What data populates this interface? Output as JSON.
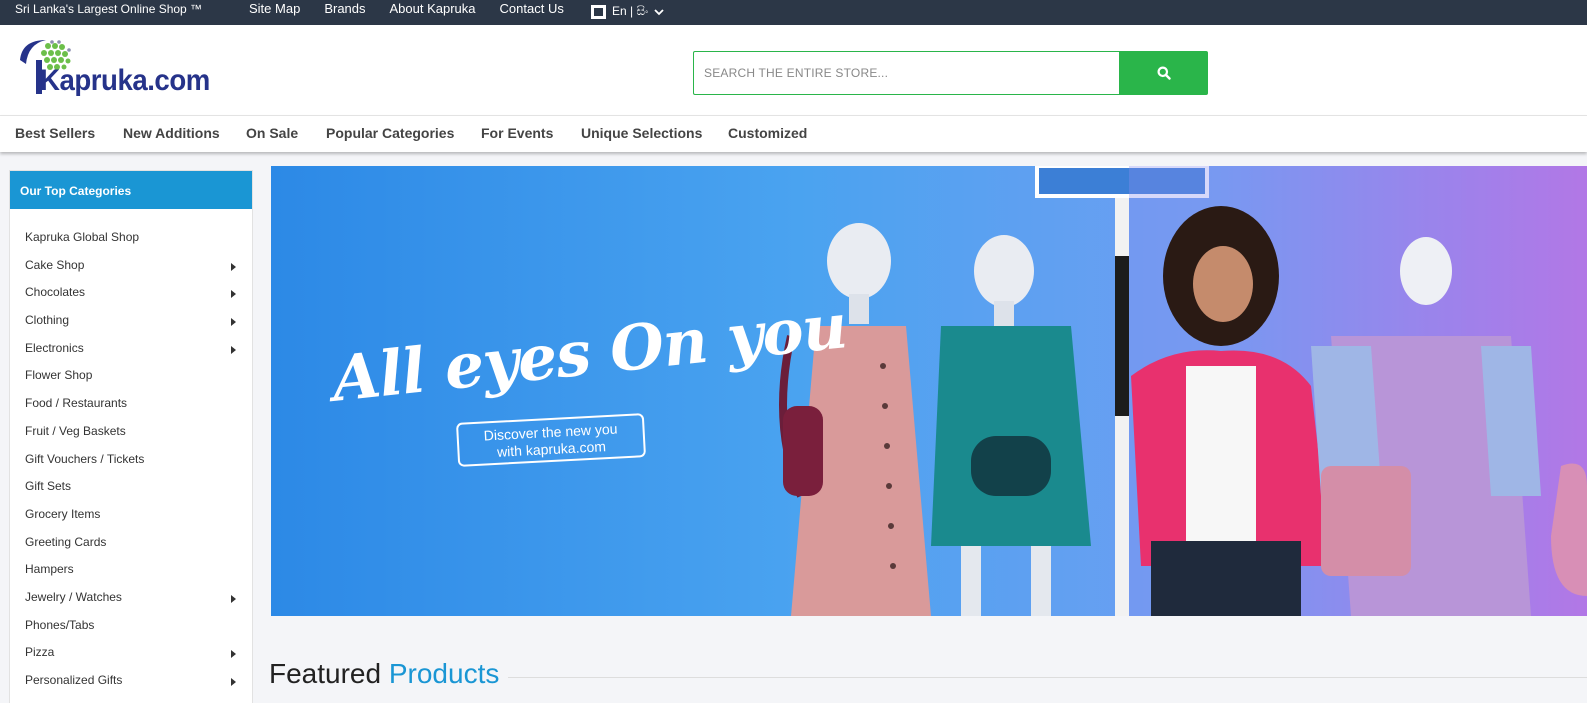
{
  "topbar": {
    "tagline": "Sri Lanka's Largest Online Shop ™",
    "links": [
      "Site Map",
      "Brands",
      "About Kapruka",
      "Contact Us"
    ],
    "language": "En | සිං"
  },
  "header": {
    "logo_text": "Kapruka.com",
    "search_placeholder": "SEARCH THE ENTIRE STORE..."
  },
  "nav": {
    "items": [
      "Best Sellers",
      "New Additions",
      "On Sale",
      "Popular Categories",
      "For Events",
      "Unique Selections",
      "Customized"
    ]
  },
  "sidebar": {
    "title": "Our Top Categories",
    "items": [
      {
        "label": "Kapruka Global Shop",
        "has_sub": false
      },
      {
        "label": "Cake Shop",
        "has_sub": true
      },
      {
        "label": "Chocolates",
        "has_sub": true
      },
      {
        "label": "Clothing",
        "has_sub": true
      },
      {
        "label": "Electronics",
        "has_sub": true
      },
      {
        "label": "Flower Shop",
        "has_sub": false
      },
      {
        "label": "Food / Restaurants",
        "has_sub": false
      },
      {
        "label": "Fruit / Veg Baskets",
        "has_sub": false
      },
      {
        "label": "Gift Vouchers / Tickets",
        "has_sub": false
      },
      {
        "label": "Gift Sets",
        "has_sub": false
      },
      {
        "label": "Grocery Items",
        "has_sub": false
      },
      {
        "label": "Greeting Cards",
        "has_sub": false
      },
      {
        "label": "Hampers",
        "has_sub": false
      },
      {
        "label": "Jewelry / Watches",
        "has_sub": true
      },
      {
        "label": "Phones/Tabs",
        "has_sub": false
      },
      {
        "label": "Pizza",
        "has_sub": true
      },
      {
        "label": "Personalized Gifts",
        "has_sub": true
      }
    ]
  },
  "banner": {
    "headline": "All eyes On you",
    "subtext_line1": "Discover the new you",
    "subtext_line2": "with kapruka.com"
  },
  "featured": {
    "word1": "Featured",
    "word2": "Products"
  },
  "colors": {
    "topbar": "#2c3747",
    "brand_blue": "#26338a",
    "search_green": "#2ab54a",
    "sidebar_head": "#1a96d4"
  }
}
